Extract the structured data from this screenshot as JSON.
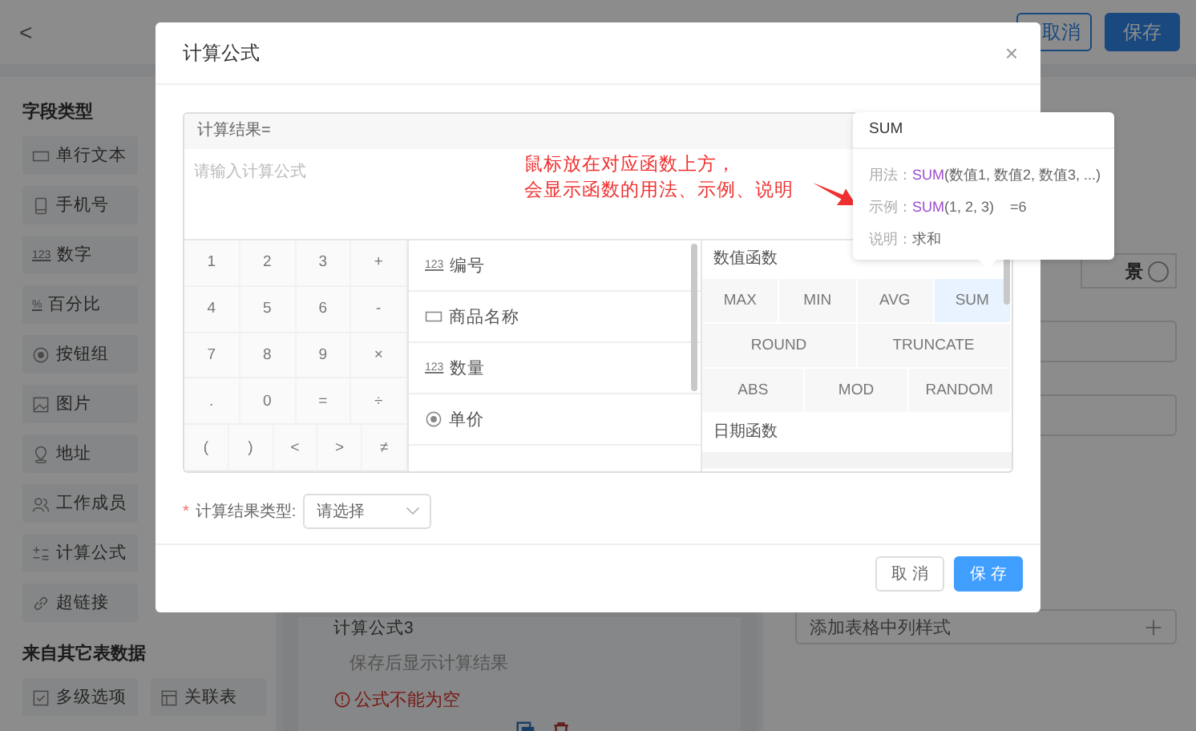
{
  "top_bar": {
    "back": "<",
    "buttons": [
      {
        "label": "取消",
        "kind": "outline"
      },
      {
        "label": "保存",
        "kind": "primary"
      }
    ]
  },
  "sidebar": {
    "title": "字段类型",
    "items": [
      {
        "label": "单行文本",
        "kind": "text"
      },
      {
        "label": "手机号",
        "kind": "phone"
      },
      {
        "label": "数字",
        "kind": "number",
        "badge": "123"
      },
      {
        "label": "百分比",
        "kind": "percent",
        "badge": "%"
      },
      {
        "label": "按钮组",
        "kind": "radio"
      },
      {
        "label": "图片",
        "kind": "image"
      },
      {
        "label": "地址",
        "kind": "address"
      },
      {
        "label": "工作成员",
        "kind": "member"
      },
      {
        "label": "计算公式",
        "kind": "formula"
      },
      {
        "label": "超链接",
        "kind": "link"
      }
    ],
    "other_title": "来自其它表数据",
    "other_items": [
      {
        "label": "多级选项",
        "kind": "multi"
      },
      {
        "label": "关联表",
        "kind": "relation"
      }
    ]
  },
  "center": {
    "heading": "计算公式3",
    "hint": "保存后显示计算结果",
    "error": "公式不能为空"
  },
  "right_panel": {
    "radio_label": "景",
    "add_column_style": "添加表格中列样式"
  },
  "dialog": {
    "title": "计算公式",
    "close": "×",
    "formula": {
      "result_label": "计算结果=",
      "placeholder": "请输入计算公式",
      "annotation": [
        "鼠标放在对应函数上方，",
        "会显示函数的用法、示例、说明"
      ]
    },
    "keypad": [
      [
        "1",
        "2",
        "3",
        "+"
      ],
      [
        "4",
        "5",
        "6",
        "-"
      ],
      [
        "7",
        "8",
        "9",
        "×"
      ],
      [
        ".",
        "0",
        "=",
        "÷"
      ],
      [
        "(",
        ")",
        "<",
        ">",
        "≠"
      ]
    ],
    "fields": [
      {
        "label": "编号",
        "kind": "number",
        "badge": "123"
      },
      {
        "label": "商品名称",
        "kind": "text"
      },
      {
        "label": "数量",
        "kind": "number",
        "badge": "123"
      },
      {
        "label": "单价",
        "kind": "radio"
      }
    ],
    "function_groups": [
      {
        "title": "数值函数",
        "rows": [
          {
            "functions": [
              {
                "name": "MAX",
                "selected": false
              },
              {
                "name": "MIN",
                "selected": false
              },
              {
                "name": "AVG",
                "selected": false
              },
              {
                "name": "SUM",
                "selected": true
              }
            ]
          },
          {
            "functions": [
              {
                "name": "ROUND",
                "selected": false
              },
              {
                "name": "TRUNCATE",
                "selected": false
              }
            ]
          },
          {
            "functions": [
              {
                "name": "ABS",
                "selected": false
              },
              {
                "name": "MOD",
                "selected": false
              },
              {
                "name": "RANDOM",
                "selected": false
              }
            ]
          }
        ]
      },
      {
        "title": "日期函数"
      }
    ],
    "result_type": {
      "required_mark": "*",
      "label": "计算结果类型:",
      "placeholder": "请选择"
    },
    "buttons": [
      {
        "label": "取 消",
        "kind": "outline"
      },
      {
        "label": "保 存",
        "kind": "primary"
      }
    ]
  },
  "tooltip": {
    "title": "SUM",
    "lines": [
      {
        "label": "用法：",
        "fn": "SUM",
        "rest": "(数值1, 数值2, 数值3, ...)"
      },
      {
        "label": "示例：",
        "fn": "SUM",
        "rest": "(1, 2, 3)    =6"
      },
      {
        "label": "说明：",
        "rest": "求和"
      }
    ]
  }
}
